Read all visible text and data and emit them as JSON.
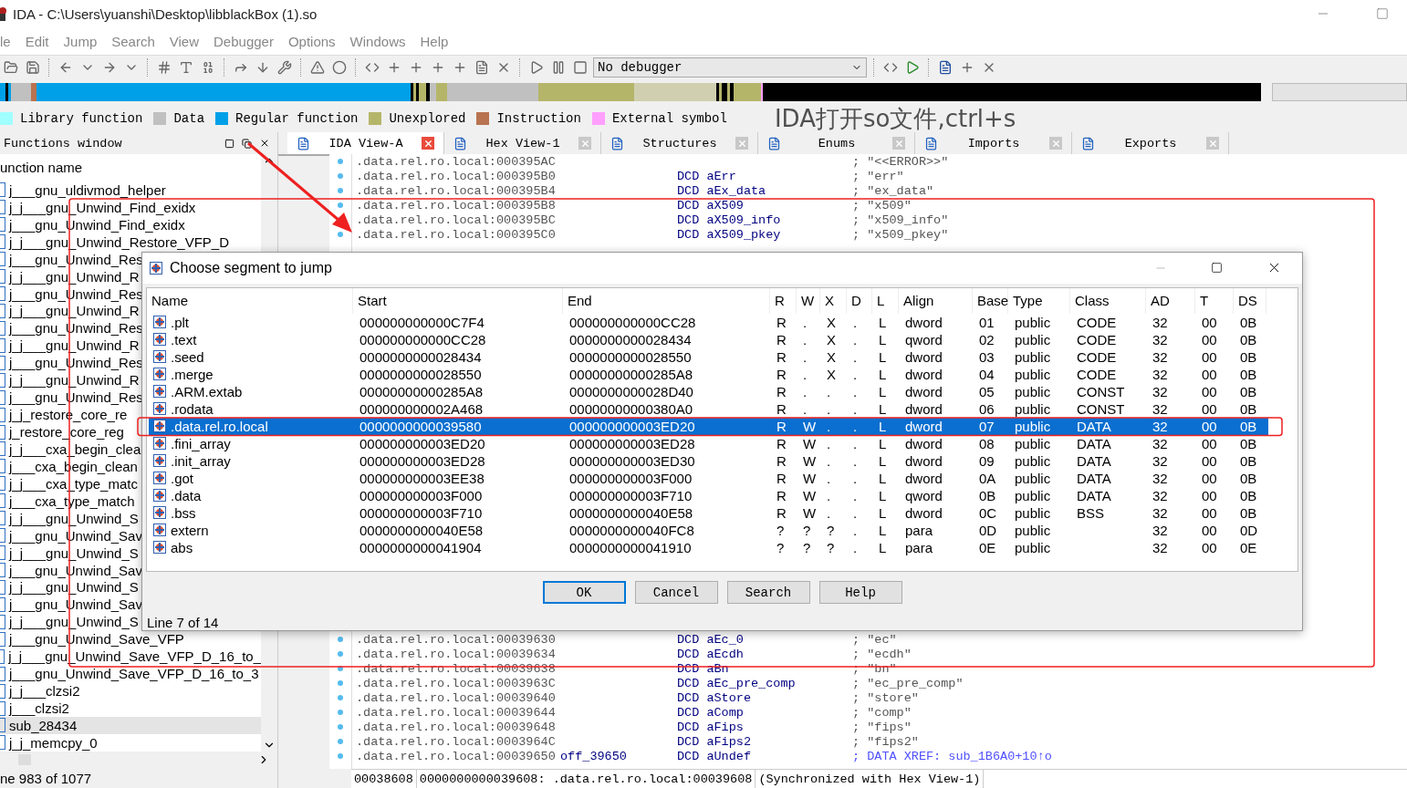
{
  "window": {
    "title": "IDA - C:\\Users\\yuanshi\\Desktop\\libblackBox (1).so"
  },
  "menu": [
    "le",
    "Edit",
    "Jump",
    "Search",
    "View",
    "Debugger",
    "Options",
    "Windows",
    "Help"
  ],
  "toolbar": {
    "debugger": "No debugger"
  },
  "legend": [
    {
      "label": "Library function",
      "color": "#a0ffff"
    },
    {
      "label": "Data",
      "color": "#c0c0c0"
    },
    {
      "label": "Regular function",
      "color": "#00a0e8"
    },
    {
      "label": "Unexplored",
      "color": "#b5b56a"
    },
    {
      "label": "Instruction",
      "color": "#b87350"
    },
    {
      "label": "External symbol",
      "color": "#ff9fff"
    }
  ],
  "annotation": {
    "text": "IDA打开so文件,ctrl+s"
  },
  "functions_window": {
    "title": "Functions window",
    "column": "unction name",
    "items": [
      {
        "name": "j___gnu_uldivmod_helper",
        "selected": false
      },
      {
        "name": "j_j___gnu_Unwind_Find_exidx",
        "selected": false
      },
      {
        "name": "j___gnu_Unwind_Find_exidx",
        "selected": false
      },
      {
        "name": "j_j___gnu_Unwind_Restore_VFP_D",
        "selected": false
      },
      {
        "name": "j___gnu_Unwind_Res",
        "selected": false
      },
      {
        "name": "j_j___gnu_Unwind_R",
        "selected": false
      },
      {
        "name": "j___gnu_Unwind_Res",
        "selected": false
      },
      {
        "name": "j_j___gnu_Unwind_R",
        "selected": false
      },
      {
        "name": "j___gnu_Unwind_Res",
        "selected": false
      },
      {
        "name": "j_j___gnu_Unwind_R",
        "selected": false
      },
      {
        "name": "j___gnu_Unwind_Res",
        "selected": false
      },
      {
        "name": "j_j___gnu_Unwind_R",
        "selected": false
      },
      {
        "name": "j___gnu_Unwind_Res",
        "selected": false
      },
      {
        "name": "j_j_restore_core_re",
        "selected": false
      },
      {
        "name": "j_restore_core_reg",
        "selected": false
      },
      {
        "name": "j_j___cxa_begin_clea",
        "selected": false
      },
      {
        "name": "j___cxa_begin_clean",
        "selected": false
      },
      {
        "name": "j_j___cxa_type_matc",
        "selected": false
      },
      {
        "name": "j___cxa_type_match",
        "selected": false
      },
      {
        "name": "j_j___gnu_Unwind_S",
        "selected": false
      },
      {
        "name": "j___gnu_Unwind_Sav",
        "selected": false
      },
      {
        "name": "j_j___gnu_Unwind_S",
        "selected": false
      },
      {
        "name": "j___gnu_Unwind_Sav",
        "selected": false
      },
      {
        "name": "j_j___gnu_Unwind_S",
        "selected": false
      },
      {
        "name": "j___gnu_Unwind_Sav",
        "selected": false
      },
      {
        "name": "j_j___gnu_Unwind_S",
        "selected": false
      },
      {
        "name": "j___gnu_Unwind_Save_VFP",
        "selected": false
      },
      {
        "name": "j_j___gnu_Unwind_Save_VFP_D_16_to_",
        "selected": false
      },
      {
        "name": "j___gnu_Unwind_Save_VFP_D_16_to_3",
        "selected": false
      },
      {
        "name": "j_j___clzsi2",
        "selected": false
      },
      {
        "name": "j___clzsi2",
        "selected": false
      },
      {
        "name": "sub_28434",
        "selected": true
      },
      {
        "name": "j_j_memcpy_0",
        "selected": false
      }
    ],
    "status": "ne 983 of 1077"
  },
  "tabs": [
    {
      "label": "IDA View-A",
      "selected": true
    },
    {
      "label": "Hex View-1",
      "selected": false
    },
    {
      "label": "Structures",
      "selected": false
    },
    {
      "label": "Enums",
      "selected": false
    },
    {
      "label": "Imports",
      "selected": false
    },
    {
      "label": "Exports",
      "selected": false
    }
  ],
  "disassembly": {
    "lines_top": [
      {
        "address": ".data.rel.ro.local:000395AC",
        "comment": "; \"<<ERROR>>\"",
        "kind": "string"
      },
      {
        "address": ".data.rel.ro.local:000395B0",
        "instruction": "DCD aErr",
        "comment": "; \"err\"",
        "kind": "string"
      },
      {
        "address": ".data.rel.ro.local:000395B4",
        "instruction": "DCD aEx_data",
        "comment": "; \"ex_data\"",
        "kind": "string"
      },
      {
        "address": ".data.rel.ro.local:000395B8",
        "instruction": "DCD aX509",
        "comment": "; \"x509\"",
        "kind": "string"
      },
      {
        "address": ".data.rel.ro.local:000395BC",
        "instruction": "DCD aX509_info",
        "comment": "; \"x509_info\"",
        "kind": "string"
      },
      {
        "address": ".data.rel.ro.local:000395C0",
        "instruction": "DCD aX509_pkey",
        "comment": "; \"x509_pkey\"",
        "kind": "string"
      }
    ],
    "lines_bottom": [
      {
        "address": ".data.rel.ro.local:00039630",
        "instruction": "DCD aEc_0",
        "comment": "; \"ec\"",
        "kind": "string"
      },
      {
        "address": ".data.rel.ro.local:00039634",
        "instruction": "DCD aEcdh",
        "comment": "; \"ecdh\"",
        "kind": "string"
      },
      {
        "address": ".data.rel.ro.local:00039638",
        "instruction": "DCD aBn",
        "comment": "; \"bn\"",
        "kind": "string"
      },
      {
        "address": ".data.rel.ro.local:0003963C",
        "instruction": "DCD aEc_pre_comp",
        "comment": "; \"ec_pre_comp\"",
        "kind": "string"
      },
      {
        "address": ".data.rel.ro.local:00039640",
        "instruction": "DCD aStore",
        "comment": "; \"store\"",
        "kind": "string"
      },
      {
        "address": ".data.rel.ro.local:00039644",
        "instruction": "DCD aComp",
        "comment": "; \"comp\"",
        "kind": "string"
      },
      {
        "address": ".data.rel.ro.local:00039648",
        "instruction": "DCD aFips",
        "comment": "; \"fips\"",
        "kind": "string"
      },
      {
        "address": ".data.rel.ro.local:0003964C",
        "instruction": "DCD aFips2",
        "comment": "; \"fips2\"",
        "kind": "string"
      },
      {
        "address": ".data.rel.ro.local:00039650",
        "label": "off_39650",
        "instruction": "DCD aUndef",
        "comment": "; DATA XREF: sub_1B6A0+10↑o",
        "kind": "xref"
      }
    ],
    "status": [
      "00038608",
      "0000000000039608: .data.rel.ro.local:00039608",
      "(Synchronized with Hex View-1)"
    ]
  },
  "dialog": {
    "title": "Choose segment to jump",
    "columns": [
      "Name",
      "Start",
      "End",
      "R",
      "W",
      "X",
      "D",
      "L",
      "Align",
      "Base",
      "Type",
      "Class",
      "AD",
      "T",
      "DS"
    ],
    "rows": [
      {
        "cells": [
          ".plt",
          "000000000000C7F4",
          "000000000000CC28",
          "R",
          ".",
          "X",
          ".",
          "L",
          "dword",
          "01",
          "public",
          "CODE",
          "32",
          "00",
          "0B"
        ],
        "selected": false
      },
      {
        "cells": [
          ".text",
          "000000000000CC28",
          "0000000000028434",
          "R",
          ".",
          "X",
          ".",
          "L",
          "qword",
          "02",
          "public",
          "CODE",
          "32",
          "00",
          "0B"
        ],
        "selected": false
      },
      {
        "cells": [
          ".seed",
          "0000000000028434",
          "0000000000028550",
          "R",
          ".",
          "X",
          ".",
          "L",
          "dword",
          "03",
          "public",
          "CODE",
          "32",
          "00",
          "0B"
        ],
        "selected": false
      },
      {
        "cells": [
          ".merge",
          "0000000000028550",
          "00000000000285A8",
          "R",
          ".",
          "X",
          ".",
          "L",
          "dword",
          "04",
          "public",
          "CODE",
          "32",
          "00",
          "0B"
        ],
        "selected": false
      },
      {
        "cells": [
          ".ARM.extab",
          "00000000000285A8",
          "0000000000028D40",
          "R",
          ".",
          ".",
          ".",
          "L",
          "dword",
          "05",
          "public",
          "CONST",
          "32",
          "00",
          "0B"
        ],
        "selected": false
      },
      {
        "cells": [
          ".rodata",
          "000000000002A468",
          "00000000000380A0",
          "R",
          ".",
          ".",
          ".",
          "L",
          "dword",
          "06",
          "public",
          "CONST",
          "32",
          "00",
          "0B"
        ],
        "selected": false
      },
      {
        "cells": [
          ".data.rel.ro.local",
          "0000000000039580",
          "000000000003ED20",
          "R",
          "W",
          ".",
          ".",
          "L",
          "dword",
          "07",
          "public",
          "DATA",
          "32",
          "00",
          "0B"
        ],
        "selected": true
      },
      {
        "cells": [
          ".fini_array",
          "000000000003ED20",
          "000000000003ED28",
          "R",
          "W",
          ".",
          ".",
          "L",
          "dword",
          "08",
          "public",
          "DATA",
          "32",
          "00",
          "0B"
        ],
        "selected": false
      },
      {
        "cells": [
          ".init_array",
          "000000000003ED28",
          "000000000003ED30",
          "R",
          "W",
          ".",
          ".",
          "L",
          "dword",
          "09",
          "public",
          "DATA",
          "32",
          "00",
          "0B"
        ],
        "selected": false
      },
      {
        "cells": [
          ".got",
          "000000000003EE38",
          "000000000003F000",
          "R",
          "W",
          ".",
          ".",
          "L",
          "dword",
          "0A",
          "public",
          "DATA",
          "32",
          "00",
          "0B"
        ],
        "selected": false
      },
      {
        "cells": [
          ".data",
          "000000000003F000",
          "000000000003F710",
          "R",
          "W",
          ".",
          ".",
          "L",
          "qword",
          "0B",
          "public",
          "DATA",
          "32",
          "00",
          "0B"
        ],
        "selected": false
      },
      {
        "cells": [
          ".bss",
          "000000000003F710",
          "0000000000040E58",
          "R",
          "W",
          ".",
          ".",
          "L",
          "dword",
          "0C",
          "public",
          "BSS",
          "32",
          "00",
          "0B"
        ],
        "selected": false
      },
      {
        "cells": [
          "extern",
          "0000000000040E58",
          "0000000000040FC8",
          "?",
          "?",
          "?",
          ".",
          "L",
          "para",
          "0D",
          "public",
          "",
          "32",
          "00",
          "0D"
        ],
        "selected": false
      },
      {
        "cells": [
          "abs",
          "0000000000041904",
          "0000000000041910",
          "?",
          "?",
          "?",
          ".",
          "L",
          "para",
          "0E",
          "public",
          "",
          "32",
          "00",
          "0E"
        ],
        "selected": false
      }
    ],
    "buttons": [
      {
        "label": "OK",
        "default": true
      },
      {
        "label": "Cancel",
        "default": false
      },
      {
        "label": "Search",
        "default": false
      },
      {
        "label": "Help",
        "default": false
      }
    ],
    "status": "Line 7 of 14"
  }
}
